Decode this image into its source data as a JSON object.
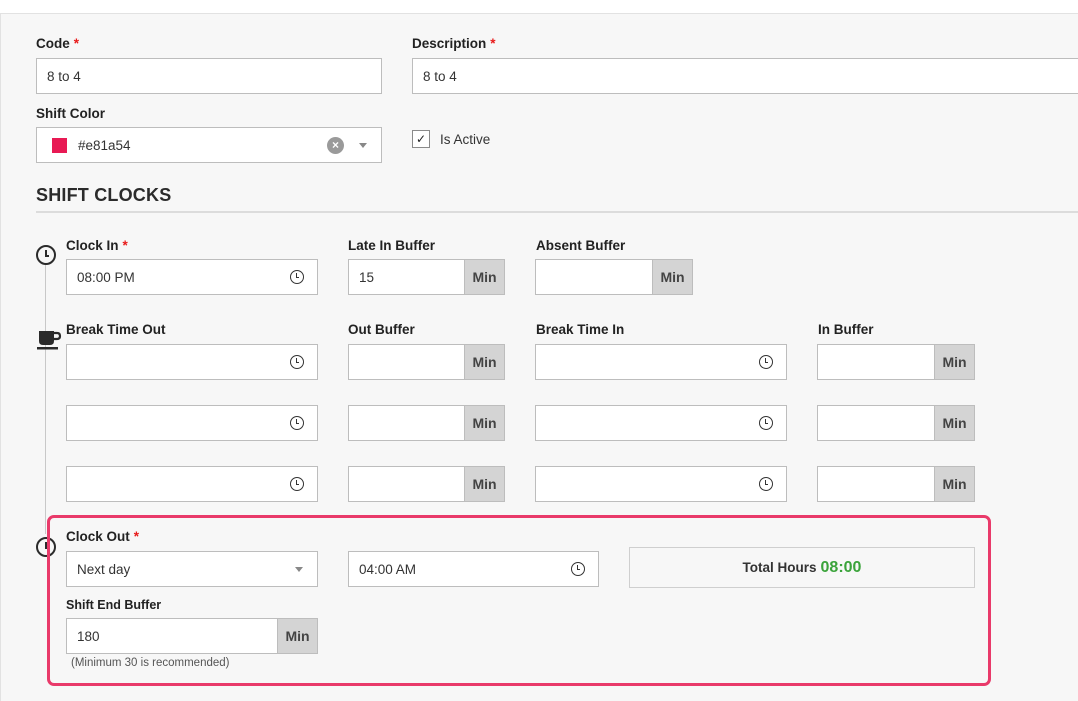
{
  "general": {
    "code_label": "Code",
    "code_value": "8 to 4",
    "description_label": "Description",
    "description_value": "8 to 4",
    "shift_color_label": "Shift Color",
    "shift_color_value": "#e81a54",
    "shift_color_swatch": "#e81a54",
    "is_active_label": "Is Active",
    "is_active_checked": true,
    "required_mark": "*"
  },
  "shift_clocks": {
    "title": "SHIFT CLOCKS",
    "clock_in": {
      "label": "Clock In",
      "value": "08:00 PM"
    },
    "late_in_buffer": {
      "label": "Late In Buffer",
      "value": "15",
      "unit": "Min"
    },
    "absent_buffer": {
      "label": "Absent Buffer",
      "value": "",
      "unit": "Min"
    },
    "breaks": {
      "break_time_out_label": "Break Time Out",
      "out_buffer_label": "Out Buffer",
      "break_time_in_label": "Break Time In",
      "in_buffer_label": "In Buffer",
      "unit": "Min",
      "rows": [
        {
          "time_out": "",
          "out_buffer": "",
          "time_in": "",
          "in_buffer": ""
        },
        {
          "time_out": "",
          "out_buffer": "",
          "time_in": "",
          "in_buffer": ""
        },
        {
          "time_out": "",
          "out_buffer": "",
          "time_in": "",
          "in_buffer": ""
        }
      ]
    },
    "clock_out": {
      "label": "Clock Out",
      "day_option": "Next day",
      "time_value": "04:00 AM"
    },
    "total_hours": {
      "label": "Total Hours",
      "value": "08:00"
    },
    "shift_end_buffer": {
      "label": "Shift End Buffer",
      "value": "180",
      "unit": "Min",
      "hint": "(Minimum 30 is recommended)"
    }
  },
  "icons": {
    "clock": "clock-icon",
    "cup": "coffee-cup-icon",
    "clear": "clear-icon",
    "caret": "chevron-down-icon",
    "check": "check-icon"
  }
}
